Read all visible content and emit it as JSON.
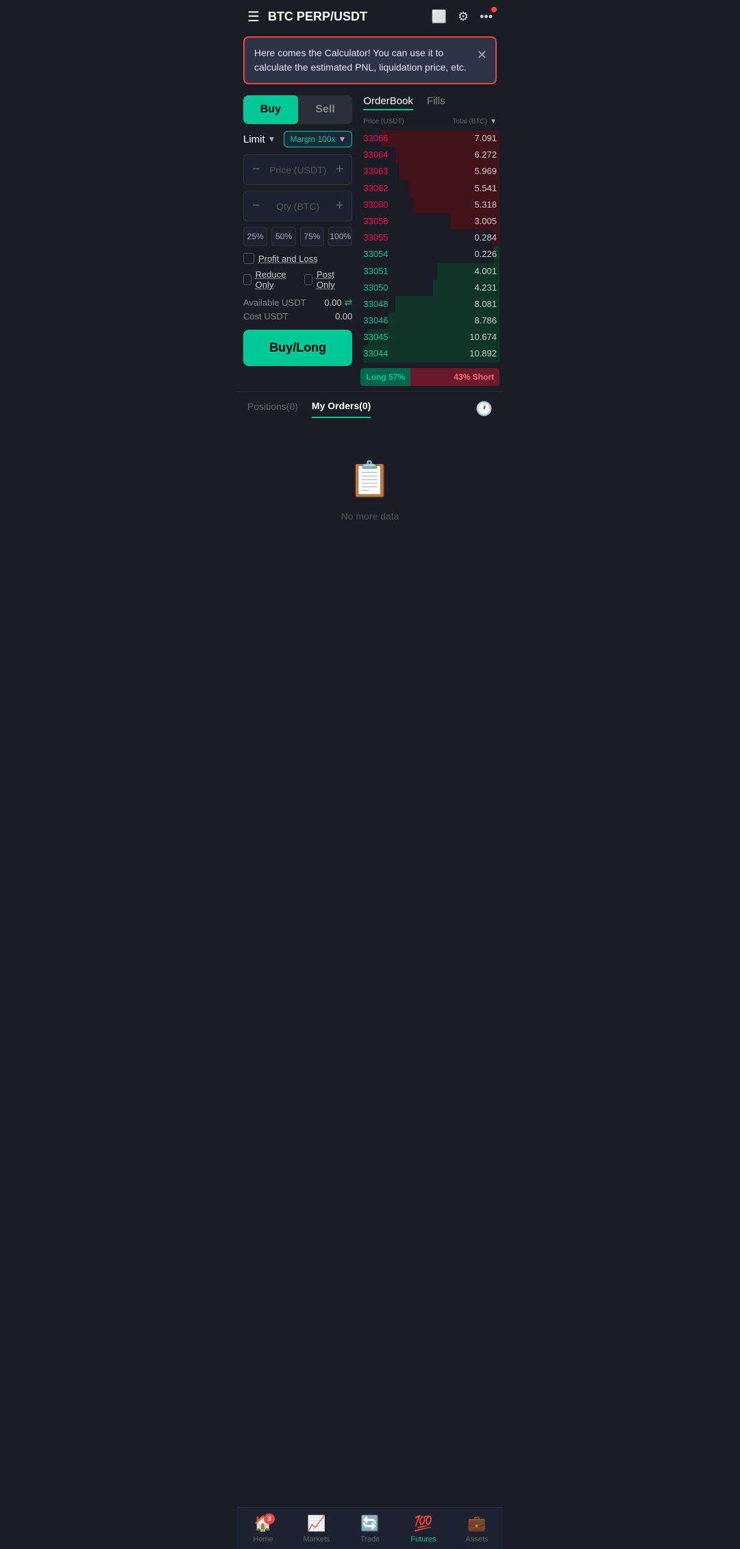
{
  "header": {
    "title": "BTC PERP/USDT",
    "menu_icon": "☰",
    "icons": [
      "🖥",
      "⚙",
      "•••"
    ]
  },
  "banner": {
    "text": "Here comes the Calculator! You can use it to calculate the estimated PNL, liquidation price, etc.",
    "close": "✕"
  },
  "trade": {
    "buy_label": "Buy",
    "sell_label": "Sell",
    "order_type": "Limit",
    "margin": "Margin 100x",
    "price_placeholder": "Price (USDT)",
    "qty_placeholder": "Qty (BTC)",
    "pct_buttons": [
      "25%",
      "50%",
      "75%",
      "100%"
    ],
    "profit_loss_label": "Profit and Loss",
    "reduce_only_label": "Reduce Only",
    "post_only_label": "Post Only",
    "available_label": "Available USDT",
    "available_value": "0.00",
    "cost_label": "Cost USDT",
    "cost_value": "0.00",
    "buy_long_label": "Buy/Long"
  },
  "orderbook": {
    "tab_orderbook": "OrderBook",
    "tab_fills": "Fills",
    "header_price": "Price (USDT)",
    "header_total": "Total (BTC)",
    "asks": [
      {
        "price": "33066",
        "total": "7.091",
        "pct": 85
      },
      {
        "price": "33064",
        "total": "6.272",
        "pct": 75
      },
      {
        "price": "33063",
        "total": "5.969",
        "pct": 72
      },
      {
        "price": "33062",
        "total": "5.541",
        "pct": 65
      },
      {
        "price": "33060",
        "total": "5.318",
        "pct": 62
      },
      {
        "price": "33058",
        "total": "3.005",
        "pct": 35
      },
      {
        "price": "33055",
        "total": "0.284",
        "pct": 5
      }
    ],
    "bids": [
      {
        "price": "33054",
        "total": "0.226",
        "pct": 4
      },
      {
        "price": "33051",
        "total": "4.001",
        "pct": 45
      },
      {
        "price": "33050",
        "total": "4.231",
        "pct": 48
      },
      {
        "price": "33048",
        "total": "8.081",
        "pct": 75
      },
      {
        "price": "33046",
        "total": "8.786",
        "pct": 80
      },
      {
        "price": "33045",
        "total": "10.674",
        "pct": 95
      },
      {
        "price": "33044",
        "total": "10.892",
        "pct": 98
      }
    ],
    "long_pct": "Long 57%",
    "short_pct": "43% Short"
  },
  "positions": {
    "tab_positions": "Positions(0)",
    "tab_orders": "My Orders(0)",
    "empty_text": "No more data"
  },
  "bottom_nav": {
    "items": [
      {
        "label": "Home",
        "icon": "🏠",
        "badge": "3"
      },
      {
        "label": "Markets",
        "icon": "📈",
        "badge": ""
      },
      {
        "label": "Trade",
        "icon": "🔄",
        "badge": ""
      },
      {
        "label": "Futures",
        "icon": "💯",
        "badge": ""
      },
      {
        "label": "Assets",
        "icon": "💼",
        "badge": ""
      }
    ]
  }
}
